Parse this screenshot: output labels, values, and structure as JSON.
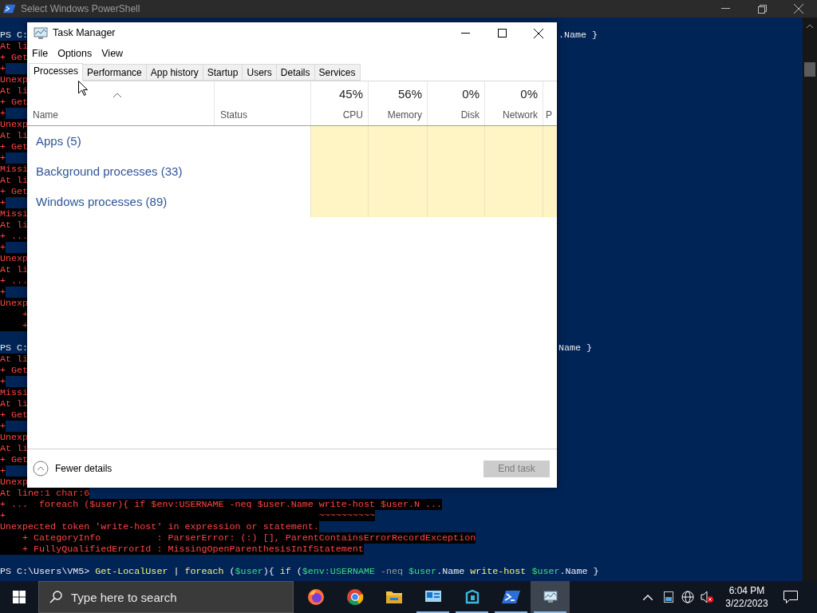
{
  "console_window": {
    "title": "Select Windows PowerShell",
    "lines": [
      {
        "kind": "prompt",
        "text": "PS C:",
        "tail": ".Name }"
      },
      {
        "kind": "error",
        "text": "At li"
      },
      {
        "kind": "error",
        "text": "+ Get"
      },
      {
        "kind": "error",
        "text": "+"
      },
      {
        "kind": "error",
        "text": "Unexp"
      },
      {
        "kind": "error",
        "text": "At li"
      },
      {
        "kind": "error",
        "text": "+ Get"
      },
      {
        "kind": "error",
        "text": "+"
      },
      {
        "kind": "error",
        "text": "Unexp"
      },
      {
        "kind": "error",
        "text": "At li"
      },
      {
        "kind": "error",
        "text": "+ Get"
      },
      {
        "kind": "error",
        "text": "+"
      },
      {
        "kind": "error",
        "text": "Missi"
      },
      {
        "kind": "error",
        "text": "At li"
      },
      {
        "kind": "error",
        "text": "+ Get"
      },
      {
        "kind": "error",
        "text": "+"
      },
      {
        "kind": "error",
        "text": "Missi"
      },
      {
        "kind": "error",
        "text": "At li"
      },
      {
        "kind": "error",
        "text": "+ ..."
      },
      {
        "kind": "error",
        "text": "+"
      },
      {
        "kind": "error",
        "text": "Unexp"
      },
      {
        "kind": "error",
        "text": "At li"
      },
      {
        "kind": "error",
        "text": "+ ..."
      },
      {
        "kind": "error",
        "text": "+"
      },
      {
        "kind": "error",
        "text": "Unexp"
      },
      {
        "kind": "error",
        "text": "    +"
      },
      {
        "kind": "error",
        "text": "    +"
      },
      {
        "kind": "blank"
      },
      {
        "kind": "prompt",
        "text": "PS C:",
        "tail": "Name }"
      },
      {
        "kind": "error",
        "text": "At li"
      },
      {
        "kind": "error",
        "text": "+ Get"
      },
      {
        "kind": "error",
        "text": "+"
      },
      {
        "kind": "error",
        "text": "Missi"
      },
      {
        "kind": "error",
        "text": "At li"
      },
      {
        "kind": "error",
        "text": "+ Get"
      },
      {
        "kind": "error",
        "text": "+"
      },
      {
        "kind": "error",
        "text": "Unexp"
      },
      {
        "kind": "error",
        "text": "At li"
      },
      {
        "kind": "error",
        "text": "+ Get"
      },
      {
        "kind": "error",
        "text": "+"
      },
      {
        "kind": "error",
        "text": "Unexp"
      },
      {
        "kind": "error",
        "text": "At line:1 char:6"
      },
      {
        "kind": "error",
        "text": "+ ...  foreach ($user){ if $env:USERNAME -neq $user.Name write-host $user.N ..."
      },
      {
        "kind": "error",
        "text": "+                                                        ~~~~~~~~~~"
      },
      {
        "kind": "error",
        "text": "Unexpected token 'write-host' in expression or statement."
      },
      {
        "kind": "error",
        "text": "    + CategoryInfo          : ParserError: (:) [], ParentContainsErrorRecordException"
      },
      {
        "kind": "error",
        "text": "    + FullyQualifiedErrorId : MissingOpenParenthesisInIfStatement"
      },
      {
        "kind": "blank"
      },
      {
        "kind": "command",
        "segments": [
          {
            "kind": "plain",
            "text": "PS C:\\Users\\VM5> "
          },
          {
            "kind": "keyword",
            "text": "Get-LocalUser"
          },
          {
            "kind": "plain",
            "text": " | "
          },
          {
            "kind": "keyword",
            "text": "foreach"
          },
          {
            "kind": "plain",
            "text": " ("
          },
          {
            "kind": "variable",
            "text": "$user"
          },
          {
            "kind": "plain",
            "text": "){ "
          },
          {
            "kind": "keyword",
            "text": "if"
          },
          {
            "kind": "plain",
            "text": " ("
          },
          {
            "kind": "variable",
            "text": "$env:USERNAME"
          },
          {
            "kind": "parameter",
            "text": " -neq "
          },
          {
            "kind": "variable",
            "text": "$user"
          },
          {
            "kind": "plain",
            "text": ".Name "
          },
          {
            "kind": "keyword",
            "text": "write-host"
          },
          {
            "kind": "variable",
            "text": " $user"
          },
          {
            "kind": "plain",
            "text": ".Name }"
          }
        ]
      }
    ]
  },
  "task_manager": {
    "title": "Task Manager",
    "menu": [
      "File",
      "Options",
      "View"
    ],
    "tabs": [
      {
        "label": "Processes",
        "selected": true
      },
      {
        "label": "Performance",
        "selected": false
      },
      {
        "label": "App history",
        "selected": false
      },
      {
        "label": "Startup",
        "selected": false
      },
      {
        "label": "Users",
        "selected": false
      },
      {
        "label": "Details",
        "selected": false
      },
      {
        "label": "Services",
        "selected": false
      }
    ],
    "columns": [
      {
        "label": "Name",
        "sorted": true
      },
      {
        "label": "Status"
      },
      {
        "value": "45%",
        "label": "CPU"
      },
      {
        "value": "56%",
        "label": "Memory"
      },
      {
        "value": "0%",
        "label": "Disk"
      },
      {
        "value": "0%",
        "label": "Network"
      },
      {
        "label": "P"
      }
    ],
    "groups": [
      "Apps (5)",
      "Background processes (33)",
      "Windows processes (89)"
    ],
    "fewer_details": "Fewer details",
    "end_task": {
      "label": "End task",
      "disabled": true
    }
  },
  "taskbar": {
    "search_placeholder": "Type here to search",
    "apps": [
      {
        "kind": "firefox",
        "running": false,
        "active": false
      },
      {
        "kind": "chrome",
        "running": false,
        "active": false
      },
      {
        "kind": "folder",
        "running": false,
        "active": false
      },
      {
        "kind": "remote",
        "running": true,
        "active": false
      },
      {
        "kind": "studio",
        "running": true,
        "active": false
      },
      {
        "kind": "powershell",
        "running": true,
        "active": false
      },
      {
        "kind": "taskmgr",
        "running": true,
        "active": true
      }
    ],
    "time": "6:04 PM",
    "date": "3/22/2023"
  }
}
